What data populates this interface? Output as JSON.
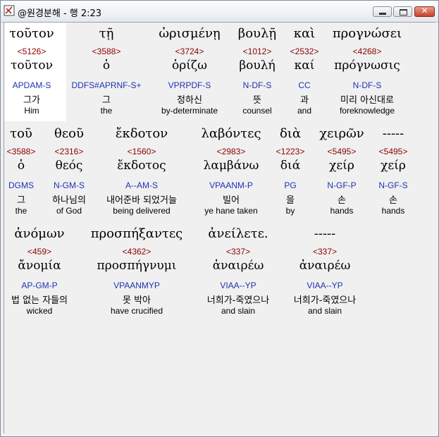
{
  "window": {
    "title": "@원경분해 - 행 2:23",
    "min_label": "",
    "max_label": "",
    "close_label": "✕"
  },
  "rows": [
    {
      "words": [
        {
          "greek": "τοῦτον",
          "strong": "<5126>",
          "lemma": "τοῦτον",
          "parse": "APDAM-S",
          "korean": "그가",
          "english": "Him"
        },
        {
          "greek": "τῇ",
          "strong": "<3588>",
          "lemma": "ὁ",
          "parse": "DDFS#APRNF-S+",
          "korean": "그",
          "english": "the"
        },
        {
          "greek": "ὡρισμένῃ",
          "strong": "<3724>",
          "lemma": "ὁρίζω",
          "parse": "VPRPDF-S",
          "korean": "정하신",
          "english": "by-determinate"
        },
        {
          "greek": "βουλῇ",
          "strong": "<1012>",
          "lemma": "βουλή",
          "parse": "N-DF-S",
          "korean": "뜻",
          "english": "counsel"
        },
        {
          "greek": "καὶ",
          "strong": "<2532>",
          "lemma": "καί",
          "parse": "CC",
          "korean": "과",
          "english": "and"
        },
        {
          "greek": "προγνώσει",
          "strong": "<4268>",
          "lemma": "πρόγνωσις",
          "parse": "N-DF-S",
          "korean": "미리 아신대로",
          "english": "foreknowledge"
        }
      ]
    },
    {
      "words": [
        {
          "greek": "τοῦ",
          "strong": "<3588>",
          "lemma": "ὁ",
          "parse": "DGMS",
          "korean": "그",
          "english": "the"
        },
        {
          "greek": "θεοῦ",
          "strong": "<2316>",
          "lemma": "θεός",
          "parse": "N-GM-S",
          "korean": "하나님의",
          "english": "of God"
        },
        {
          "greek": "ἔκδοτον",
          "strong": "<1560>",
          "lemma": "ἔκδοτος",
          "parse": "A--AM-S",
          "korean": "내어준바 되었거늘",
          "english": "being delivered"
        },
        {
          "greek": "λαβόντες",
          "strong": "<2983>",
          "lemma": "λαμβάνω",
          "parse": "VPAANM-P",
          "korean": "빌어",
          "english": "ye hane taken"
        },
        {
          "greek": "διὰ",
          "strong": "<1223>",
          "lemma": "διά",
          "parse": "PG",
          "korean": "을",
          "english": "by"
        },
        {
          "greek": "χειρῶν",
          "strong": "<5495>",
          "lemma": "χείρ",
          "parse": "N-GF-P",
          "korean": "손",
          "english": "hands"
        },
        {
          "greek": "-----",
          "strong": "<5495>",
          "lemma": "χείρ",
          "parse": "N-GF-S",
          "korean": "손",
          "english": "hands"
        }
      ]
    },
    {
      "words": [
        {
          "greek": "ἀνόμων",
          "strong": "<459>",
          "lemma": "ἄνομία",
          "parse": "AP-GM-P",
          "korean": "법 없는 자들의",
          "english": "wicked"
        },
        {
          "greek": "προσπήξαντες",
          "strong": "<4362>",
          "lemma": "προσπήγνυμι",
          "parse": "VPAANMYP",
          "korean": "못 박아",
          "english": "have crucified"
        },
        {
          "greek": "ἀνείλετε.",
          "strong": "<337>",
          "lemma": "ἀναιρέω",
          "parse": "VIAA--YP",
          "korean": "너희가-죽였으나",
          "english": "and slain"
        },
        {
          "greek": "-----",
          "strong": "<337>",
          "lemma": "ἀναιρέω",
          "parse": "VIAA--YP",
          "korean": "너희가-죽였으나",
          "english": "and slain"
        }
      ]
    }
  ]
}
